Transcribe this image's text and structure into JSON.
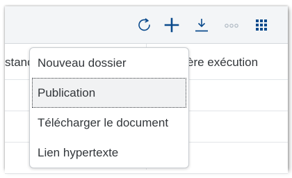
{
  "toolbar": {
    "buttons": [
      {
        "icon": "refresh-icon"
      },
      {
        "icon": "add-icon"
      },
      {
        "icon": "download-icon"
      },
      {
        "icon": "more-options-icon"
      },
      {
        "icon": "grid-view-icon"
      }
    ]
  },
  "table": {
    "headers": [
      "stanc",
      "ère exécution"
    ]
  },
  "menu": {
    "items": [
      "Nouveau dossier",
      "Publication",
      "Télécharger le document",
      "Lien hypertexte"
    ],
    "focused_index": 1
  },
  "colors": {
    "accent": "#0a4a8c",
    "toolbar_bg": "#f3f5f7",
    "more_icon": "#a9b4be"
  }
}
